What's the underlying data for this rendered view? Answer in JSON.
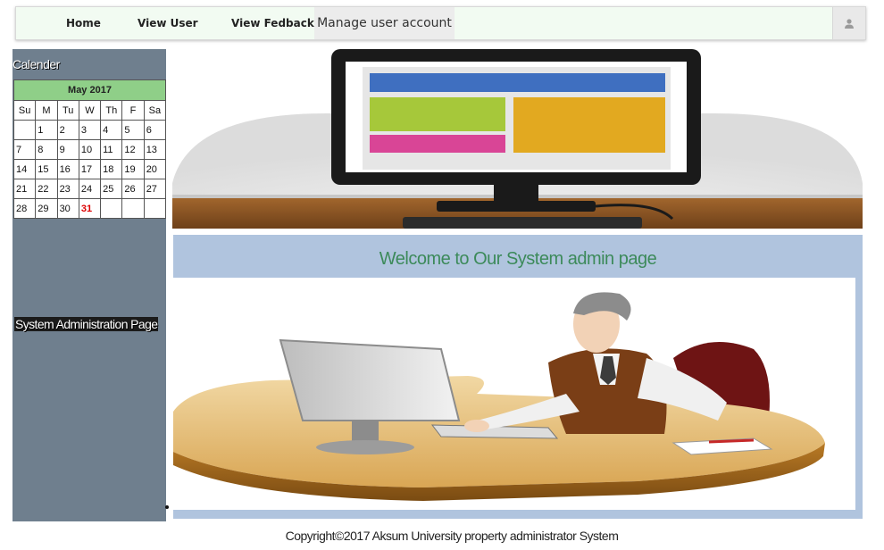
{
  "nav": {
    "home": "Home",
    "view_user": "View User",
    "view_feedback": "View Fedback",
    "manage": "Manage user account",
    "user_icon": "user-icon"
  },
  "sidebar": {
    "calendar_title": "Calender",
    "calendar": {
      "month": "May 2017",
      "days": [
        "Su",
        "M",
        "Tu",
        "W",
        "Th",
        "F",
        "Sa"
      ],
      "weeks": [
        [
          "",
          "1",
          "2",
          "3",
          "4",
          "5",
          "6"
        ],
        [
          "7",
          "8",
          "9",
          "10",
          "11",
          "12",
          "13"
        ],
        [
          "14",
          "15",
          "16",
          "17",
          "18",
          "19",
          "20"
        ],
        [
          "21",
          "22",
          "23",
          "24",
          "25",
          "26",
          "27"
        ],
        [
          "28",
          "29",
          "30",
          "31",
          "",
          "",
          ""
        ]
      ],
      "highlighted": "31"
    },
    "admin_label": "System Administration Page"
  },
  "main": {
    "welcome": "Welcome to Our System admin page"
  },
  "footer": {
    "copyright": "Copyright©2017 Aksum University property administrator System"
  },
  "colors": {
    "sidebar": "#6f7f8e",
    "panel": "#b0c4de",
    "calendar_header": "#8fcf88",
    "welcome_text": "#3c8a5a"
  }
}
